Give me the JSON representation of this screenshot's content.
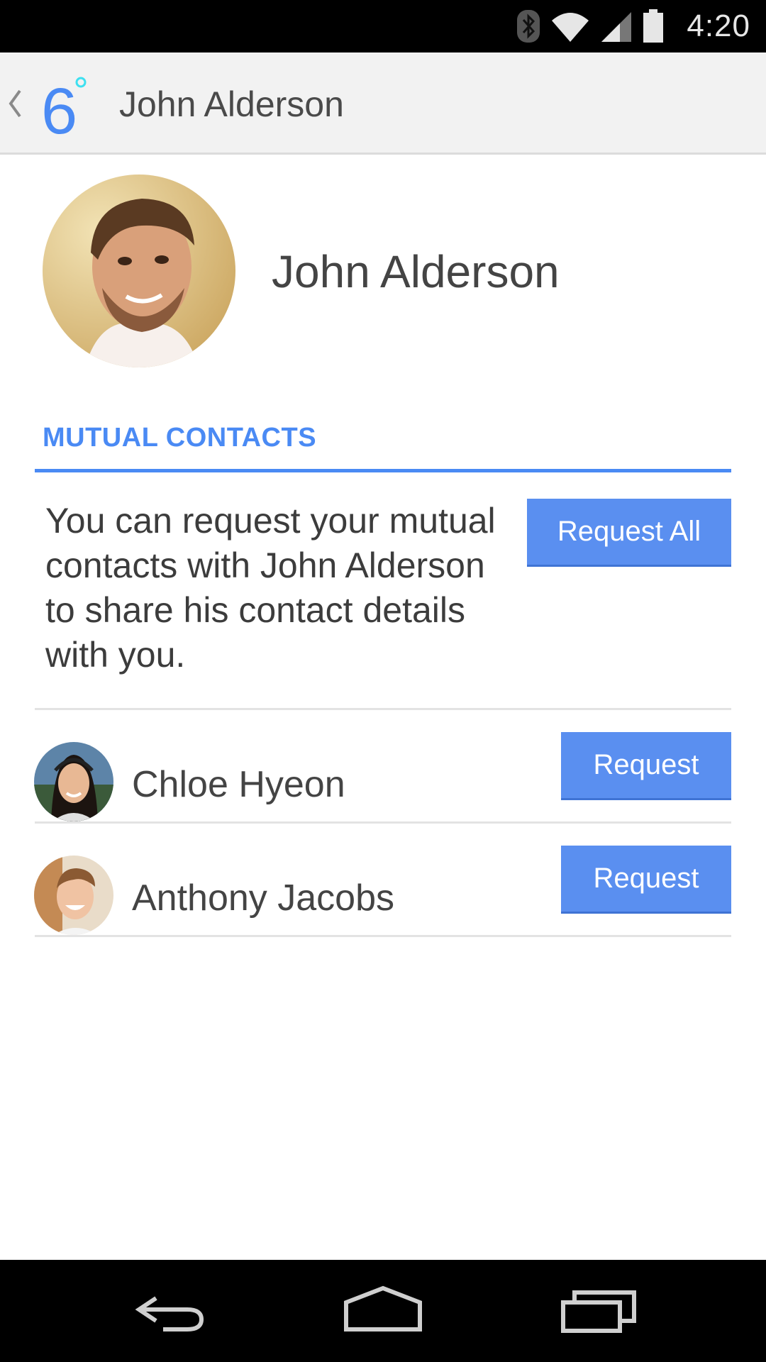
{
  "status_bar": {
    "time": "4:20",
    "icons": [
      "bluetooth-icon",
      "wifi-icon",
      "cell-signal-icon",
      "battery-icon"
    ]
  },
  "app_bar": {
    "title": "John Alderson",
    "logo_text": "6",
    "logo_color": "#4a8af4",
    "logo_dot_color": "#3ee0f0"
  },
  "profile": {
    "name": "John Alderson"
  },
  "mutual_contacts": {
    "header": "MUTUAL CONTACTS",
    "description": "You can request your mutual contacts with John Alderson to share his contact details with you.",
    "request_all_label": "Request All",
    "contacts": [
      {
        "name": "Chloe Hyeon",
        "button_label": "Request"
      },
      {
        "name": "Anthony Jacobs",
        "button_label": "Request"
      }
    ]
  },
  "colors": {
    "accent": "#4a8af4",
    "button": "#5a8ff0"
  },
  "nav_bar": {
    "icons": [
      "back-icon",
      "home-icon",
      "recents-icon"
    ]
  }
}
